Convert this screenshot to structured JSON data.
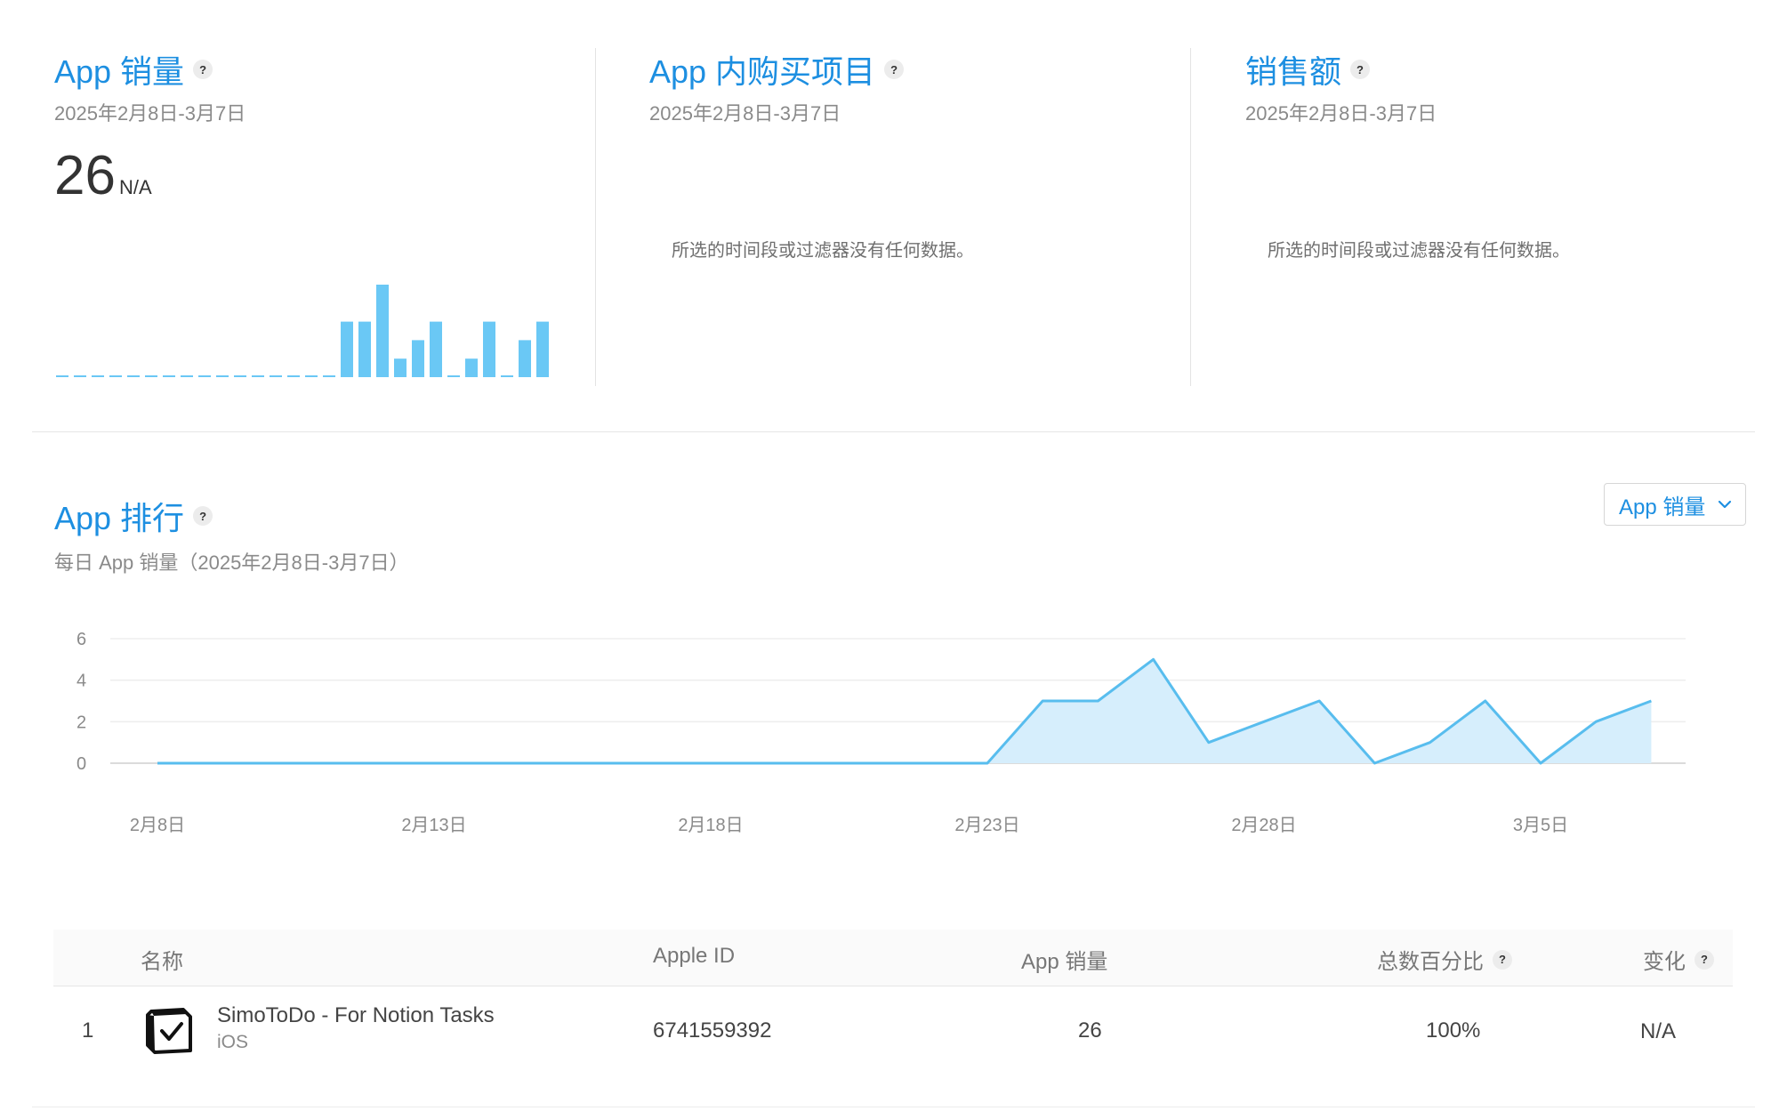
{
  "cards": [
    {
      "title": "App 销量",
      "date_range": "2025年2月8日-3月7日",
      "value": "26",
      "change": "N/A"
    },
    {
      "title": "App 内购买项目",
      "date_range": "2025年2月8日-3月7日",
      "empty_message": "所选的时间段或过滤器没有任何数据。"
    },
    {
      "title": "销售额",
      "date_range": "2025年2月8日-3月7日",
      "empty_message": "所选的时间段或过滤器没有任何数据。"
    }
  ],
  "help_glyph": "?",
  "ranking": {
    "title": "App 排行",
    "subtitle": "每日 App 销量（2025年2月8日-3月7日）",
    "dropdown_label": "App 销量"
  },
  "colors": {
    "accent": "#1d8fe1",
    "bar": "#6ac8f5",
    "line": "#58bdee",
    "area": "#d6eefc"
  },
  "chart_data": [
    {
      "type": "bar",
      "values": [
        0,
        0,
        0,
        0,
        0,
        0,
        0,
        0,
        0,
        0,
        0,
        0,
        0,
        0,
        0,
        0,
        3,
        3,
        5,
        1,
        2,
        3,
        0,
        1,
        3,
        0,
        2,
        3
      ]
    },
    {
      "type": "area",
      "x": [
        "2月8日",
        "2月9日",
        "2月10日",
        "2月11日",
        "2月12日",
        "2月13日",
        "2月14日",
        "2月15日",
        "2月16日",
        "2月17日",
        "2月18日",
        "2月19日",
        "2月20日",
        "2月21日",
        "2月22日",
        "2月23日",
        "2月24日",
        "2月25日",
        "2月26日",
        "2月27日",
        "2月28日",
        "3月1日",
        "3月2日",
        "3月3日",
        "3月4日",
        "3月5日",
        "3月6日",
        "3月7日"
      ],
      "series": [
        {
          "values": [
            0,
            0,
            0,
            0,
            0,
            0,
            0,
            0,
            0,
            0,
            0,
            0,
            0,
            0,
            0,
            0,
            3,
            3,
            5,
            1,
            2,
            3,
            0,
            1,
            3,
            0,
            2,
            3
          ]
        }
      ],
      "x_tick_labels": [
        "2月8日",
        "2月13日",
        "2月18日",
        "2月23日",
        "2月28日",
        "3月5日"
      ],
      "y_ticks": [
        0,
        2,
        4,
        6
      ],
      "ylim": [
        0,
        6
      ],
      "grid": true
    }
  ],
  "table": {
    "headers": {
      "name": "名称",
      "apple_id": "Apple ID",
      "units": "App 销量",
      "percent": "总数百分比",
      "change": "变化"
    },
    "rows": [
      {
        "rank": "1",
        "name": "SimoToDo - For Notion Tasks",
        "platform": "iOS",
        "apple_id": "6741559392",
        "units": "26",
        "percent": "100%",
        "change": "N/A",
        "icon": "checkbox-app-icon"
      }
    ]
  }
}
